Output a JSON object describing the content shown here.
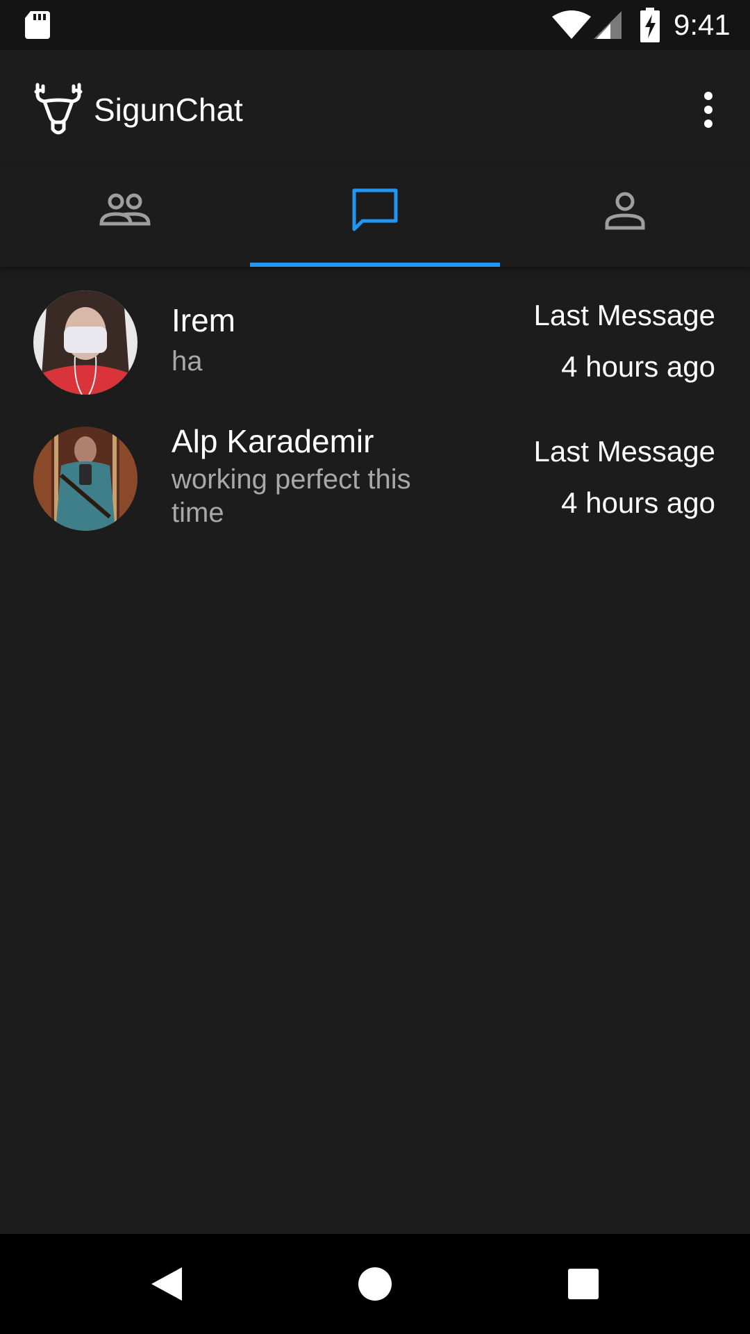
{
  "status_bar": {
    "time": "9:41",
    "icons": [
      "sd-card-icon",
      "wifi-icon",
      "signal-icon",
      "battery-charging-icon"
    ]
  },
  "app_bar": {
    "title": "SigunChat",
    "logo_icon": "deer-logo-icon",
    "menu_icon": "more-vert-icon"
  },
  "tabs": [
    {
      "icon": "people-icon",
      "active": false
    },
    {
      "icon": "chat-icon",
      "active": true
    },
    {
      "icon": "person-icon",
      "active": false
    }
  ],
  "colors": {
    "accent": "#2196f3",
    "background": "#1c1c1c",
    "status_bar": "#141414",
    "inactive_icon": "#9e9e9e",
    "preview_text": "#a8a8a8",
    "nav_bar": "#000000"
  },
  "chats": [
    {
      "name": "Irem",
      "preview": "ha",
      "meta_label": "Last Message",
      "meta_time": "4 hours ago",
      "avatar_icon": "avatar-photo"
    },
    {
      "name": "Alp Karademir",
      "preview": "working perfect this time",
      "meta_label": "Last Message",
      "meta_time": "4 hours ago",
      "avatar_icon": "avatar-photo"
    }
  ],
  "nav_bar": {
    "icons": [
      "back-icon",
      "home-icon",
      "recents-icon"
    ]
  }
}
